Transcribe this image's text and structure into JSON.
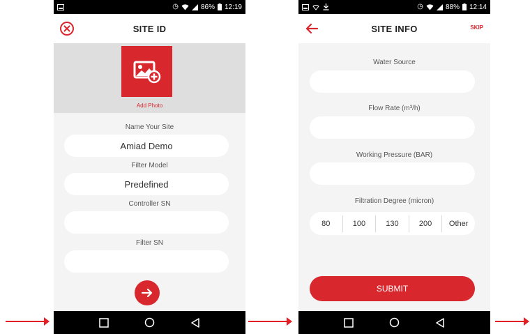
{
  "screen1": {
    "status": {
      "battery": "86%",
      "time": "12:19"
    },
    "title": "SITE ID",
    "add_photo_label": "Add Photo",
    "fields": [
      {
        "label": "Name Your Site",
        "value": "Amiad Demo"
      },
      {
        "label": "Filter Model",
        "value": "Predefined"
      },
      {
        "label": "Controller SN",
        "value": ""
      },
      {
        "label": "Filter SN",
        "value": ""
      }
    ]
  },
  "screen2": {
    "status": {
      "battery": "88%",
      "time": "12:14"
    },
    "title": "SITE INFO",
    "skip_label": "SKIP",
    "fields": [
      {
        "label": "Water Source",
        "value": ""
      },
      {
        "label": "Flow Rate (m³/h)",
        "value": ""
      },
      {
        "label": "Working Pressure (BAR)",
        "value": ""
      }
    ],
    "filtration": {
      "label": "Filtration Degree (micron)",
      "options": [
        "80",
        "100",
        "130",
        "200",
        "Other"
      ]
    },
    "submit_label": "SUBMIT"
  },
  "colors": {
    "accent": "#d9272e",
    "arrow": "#e31e24",
    "background": "#f4f4f4"
  }
}
